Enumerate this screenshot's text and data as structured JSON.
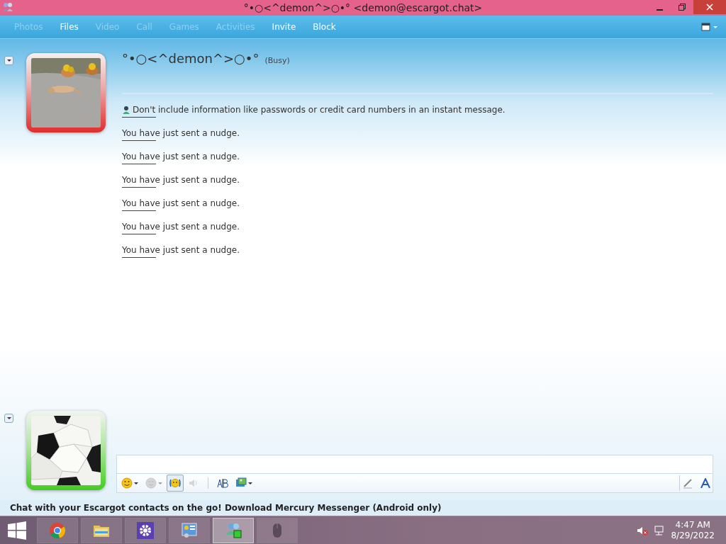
{
  "window": {
    "title": "°•○<^demon^>○•° <demon@escargot.chat>"
  },
  "menu": [
    {
      "label": "Photos",
      "disabled": true
    },
    {
      "label": "Files",
      "disabled": false
    },
    {
      "label": "Video",
      "disabled": true
    },
    {
      "label": "Call",
      "disabled": true
    },
    {
      "label": "Games",
      "disabled": true
    },
    {
      "label": "Activities",
      "disabled": true
    },
    {
      "label": "Invite",
      "disabled": false
    },
    {
      "label": "Block",
      "disabled": false
    }
  ],
  "contact": {
    "name": "°•○<^demon^>○•°",
    "status_text": "(Busy)"
  },
  "avatars": [
    {
      "color": "#e02c2c"
    },
    {
      "color": "#44cc22"
    }
  ],
  "warning": "Don't include information like passwords or credit card numbers in an instant message.",
  "messages": [
    "You have just sent a nudge.",
    "You have just sent a nudge.",
    "You have just sent a nudge.",
    "You have just sent a nudge.",
    "You have just sent a nudge.",
    "You have just sent a nudge."
  ],
  "toolbar": [
    {
      "kind": "emoticon",
      "caret": true,
      "selected": false,
      "disabled": false
    },
    {
      "kind": "wink",
      "caret": true,
      "selected": false,
      "disabled": true
    },
    {
      "kind": "nudge",
      "caret": false,
      "selected": true,
      "disabled": false
    },
    {
      "kind": "voice",
      "caret": false,
      "selected": false,
      "disabled": true
    },
    {
      "kind": "separator"
    },
    {
      "kind": "spell",
      "caret": false,
      "selected": false,
      "disabled": false
    },
    {
      "kind": "background",
      "caret": true,
      "selected": false,
      "disabled": false
    }
  ],
  "footer": "Chat with your Escargot contacts on the go! Download Mercury Messenger (Android only)",
  "taskbar": {
    "apps": [
      {
        "kind": "chrome",
        "active": false
      },
      {
        "kind": "folder",
        "active": false
      },
      {
        "kind": "gear",
        "active": false
      },
      {
        "kind": "panel",
        "active": false
      },
      {
        "kind": "messenger",
        "active": true
      },
      {
        "kind": "mouse",
        "active": false
      }
    ],
    "time": "4:47 AM",
    "date": "8/29/2022"
  }
}
